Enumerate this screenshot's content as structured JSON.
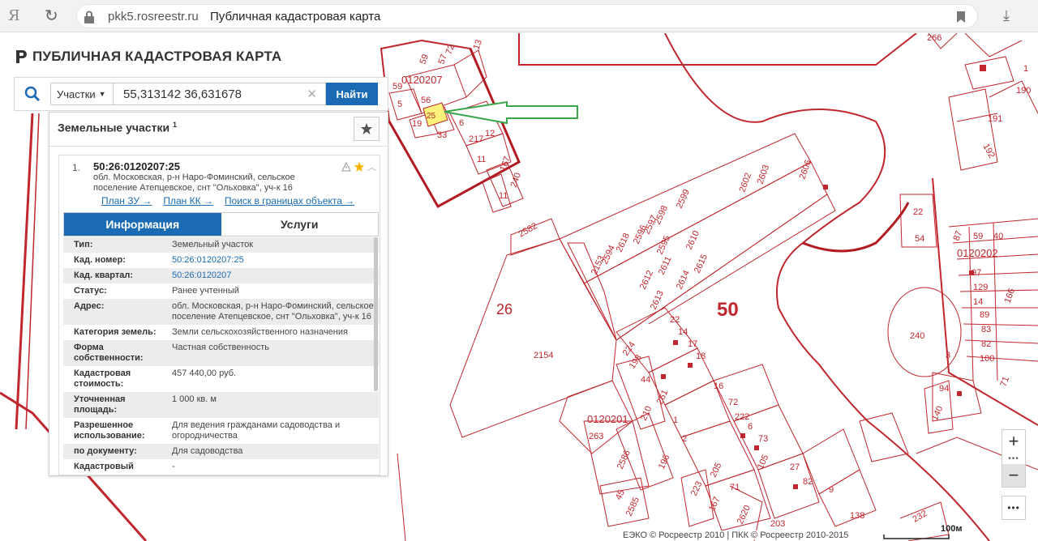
{
  "browser": {
    "host": "pkk5.rosreestr.ru",
    "title": "Публичная кадастровая карта",
    "yandex": "Я"
  },
  "app": {
    "title": "ПУБЛИЧНАЯ КАДАСТРОВАЯ КАРТА"
  },
  "search": {
    "type_label": "Участки",
    "query": "55,313142 36,631678",
    "button": "Найти"
  },
  "panel": {
    "title": "Земельные участки",
    "count": "1",
    "item": {
      "index": "1.",
      "cad_number": "50:26:0120207:25",
      "address": "обл. Московская, р-н Наро-Фоминский, сельское поселение Атепцевское, снт \"Ольховка\", уч-к 16",
      "links": [
        "План ЗУ →",
        "План КК →",
        "Поиск в границах объекта →"
      ]
    },
    "tabs": [
      "Информация",
      "Услуги"
    ],
    "rows": [
      {
        "key": "Тип:",
        "val": "Земельный участок"
      },
      {
        "key": "Кад. номер:",
        "val": "50:26:0120207:25"
      },
      {
        "key": "Кад. квартал:",
        "val": "50:26:0120207"
      },
      {
        "key": "Статус:",
        "val": "Ранее учтенный"
      },
      {
        "key": "Адрес:",
        "val": "обл. Московская, р-н Наро-Фоминский, сельское поселение Атепцевское, снт \"Ольховка\", уч-к 16"
      },
      {
        "key": "Категория земель:",
        "val": "Земли сельскохозяйственного назначения"
      },
      {
        "key": "Форма собственности:",
        "val": "Частная собственность"
      },
      {
        "key": "Кадастровая стоимость:",
        "val": "457 440,00 руб."
      },
      {
        "key": "Уточненная площадь:",
        "val": "1 000 кв. м"
      },
      {
        "key": "Разрешенное использование:",
        "val": "Для ведения гражданами садоводства и огородничества"
      },
      {
        "key": "по документу:",
        "val": "Для садоводства"
      },
      {
        "key": "Кадастровый",
        "val": "-"
      }
    ]
  },
  "map": {
    "big_labels": [
      "26",
      "50"
    ],
    "quarters": [
      "0120207",
      "0120201",
      "0120202"
    ],
    "parcels_top": [
      "59",
      "57",
      "72",
      "13",
      "5",
      "56",
      "25",
      "19",
      "6",
      "33",
      "217",
      "12",
      "11",
      "167",
      "240",
      "11"
    ],
    "parcels_mid": [
      "2582",
      "2153",
      "2154",
      "2594",
      "2618",
      "2596",
      "2597",
      "2598",
      "2599",
      "2602",
      "2603",
      "2604",
      "2595",
      "2610",
      "2611",
      "2612",
      "2613",
      "2614",
      "2615"
    ],
    "parcels_low": [
      "22",
      "14",
      "17",
      "18",
      "224",
      "198",
      "44",
      "261",
      "210",
      "263",
      "2586",
      "196",
      "1",
      "2",
      "16",
      "72",
      "222",
      "6",
      "73",
      "105",
      "27",
      "82",
      "9",
      "223",
      "205",
      "71",
      "167",
      "2620",
      "203",
      "138",
      "2585",
      "45"
    ],
    "parcels_right": [
      "266",
      "1",
      "190",
      "191",
      "192",
      "22",
      "54",
      "87",
      "59",
      "40",
      "97",
      "129",
      "14",
      "89",
      "83",
      "82",
      "100",
      "166",
      "240",
      "3",
      "94",
      "71",
      "140",
      "232"
    ],
    "scale": "100м"
  },
  "controls": {
    "zoom_in": "+",
    "zoom_out": "−",
    "dots": "•••",
    "more": "•••"
  },
  "copyright": "ЕЭКО © Росреестр 2010 | ПКК © Росреестр 2010-2015",
  "colors": {
    "parcel_line": "#c0262d",
    "selected_parcel": "#fff27a",
    "arrow": "#3aa64a",
    "accent": "#1a6bb3"
  }
}
